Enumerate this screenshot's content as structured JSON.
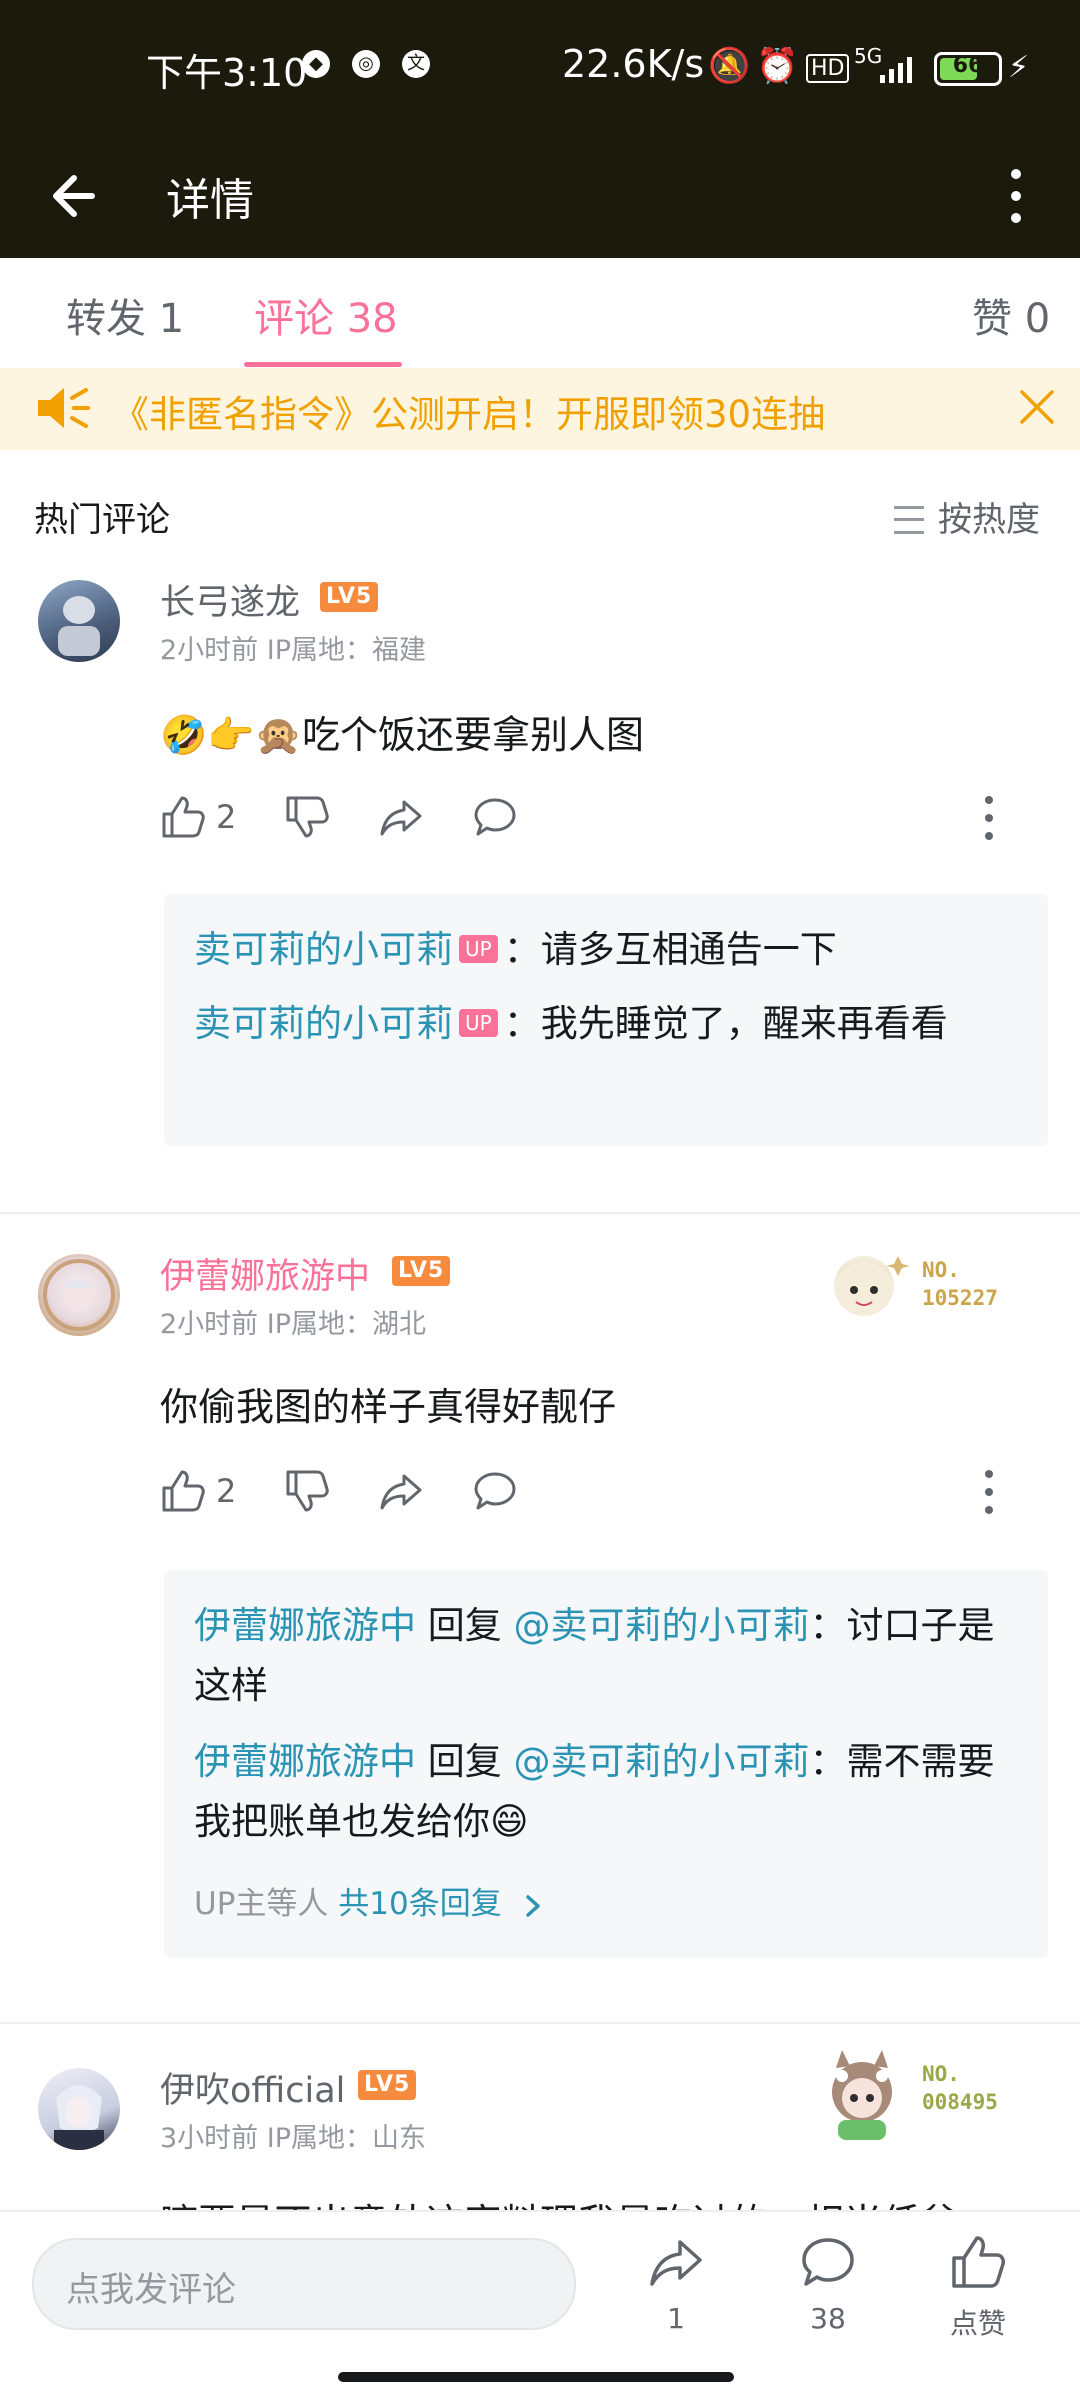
{
  "status": {
    "time": "下午3:10",
    "net_speed": "22.6K/s",
    "network": "5G",
    "battery": "66",
    "battery_level": 0.66,
    "app_icons": [
      "cyan-app-icon",
      "purple-app-icon",
      "translate-app-icon"
    ]
  },
  "appbar": {
    "title": "详情"
  },
  "tabs": {
    "repost": "转发 1",
    "comment": "评论 38",
    "like": "赞 0"
  },
  "banner": {
    "text": "《非匿名指令》公测开启！开服即领30连抽"
  },
  "section": {
    "title": "热门评论",
    "sort": "按热度"
  },
  "comments": [
    {
      "name": "长弓遂龙",
      "name_color": "#61666d",
      "level": "LV5",
      "meta": "2小时前  IP属地：福建",
      "text": "🤣👉🙊吃个饭还要拿别人图",
      "likes": "2",
      "replies": [
        {
          "name": "卖可莉的小可莉",
          "badge": "UP",
          "text": "：请多互相通告一下"
        },
        {
          "name": "卖可莉的小可莉",
          "badge": "UP",
          "text": "：我先睡觉了，醒来再看看"
        }
      ]
    },
    {
      "name": "伊蕾娜旅游中",
      "name_color": "#fb7299",
      "level": "LV5",
      "meta": "2小时前  IP属地：湖北",
      "text": "你偷我图的样子真得好靓仔",
      "likes": "2",
      "pendant_no": "NO.\n105227",
      "replies": [
        {
          "name": "伊蕾娜旅游中",
          "reply_word": " 回复 ",
          "target": "@卖可莉的小可莉",
          "text": "：讨口子是这样"
        },
        {
          "name": "伊蕾娜旅游中",
          "reply_word": " 回复 ",
          "target": "@卖可莉的小可莉",
          "text": "：需不需要我把账单也发给你😄"
        }
      ],
      "more": {
        "prefix": "UP主等人 ",
        "count": "共10条回复"
      }
    },
    {
      "name": "伊吹official",
      "name_color": "#61666d",
      "level": "LV5",
      "meta": "3小时前  IP属地：山东",
      "text": "嘛要是不出意外这家料理我是吃过的，相当低贫",
      "pendant_no": "NO.\n008495"
    }
  ],
  "bottombar": {
    "placeholder": "点我发评论",
    "share_count": "1",
    "comment_count": "38",
    "like_label": "点赞"
  },
  "colors": {
    "accent": "#fb7299",
    "link": "#2b93b3",
    "level_badge": "#f78b3d",
    "banner_text": "#f0a100",
    "header_bg": "#1b1a0c"
  }
}
